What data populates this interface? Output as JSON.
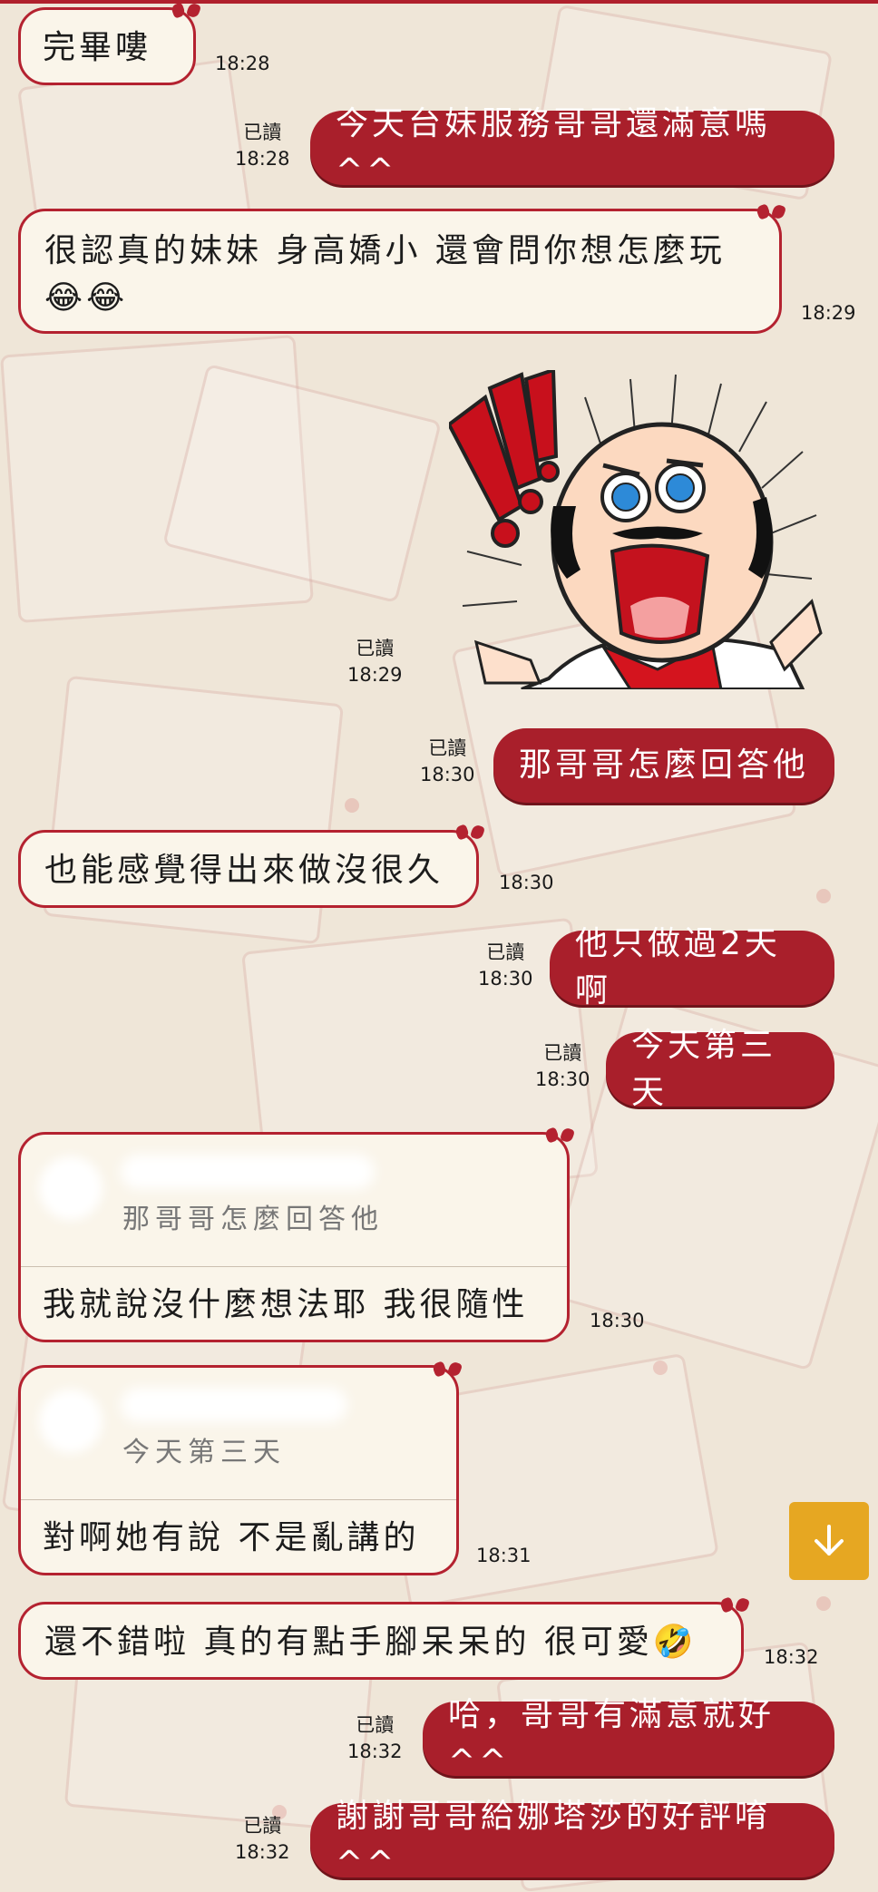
{
  "read_label": "已讀",
  "messages": [
    {
      "id": "m1",
      "side": "in",
      "text": "完畢嘍",
      "time": "18:28"
    },
    {
      "id": "m2",
      "side": "out",
      "text": "今天台妹服務哥哥還滿意嗎^^",
      "time": "18:28"
    },
    {
      "id": "m3",
      "side": "in",
      "text": "很認真的妹妹 身高嬌小 還會問你想怎麼玩😂😂",
      "time": "18:29"
    },
    {
      "id": "m4",
      "side": "out",
      "type": "sticker",
      "sticker": "shocked-old-man-sticker",
      "time": "18:29"
    },
    {
      "id": "m5",
      "side": "out",
      "text": "那哥哥怎麼回答他",
      "time": "18:30"
    },
    {
      "id": "m6",
      "side": "in",
      "text": "也能感覺得出來做沒很久",
      "time": "18:30"
    },
    {
      "id": "m7",
      "side": "out",
      "text": "他只做過2天啊",
      "time": "18:30"
    },
    {
      "id": "m8",
      "side": "out",
      "text": "今天第三天",
      "time": "18:30"
    },
    {
      "id": "m9",
      "side": "in",
      "type": "reply",
      "quote": "那哥哥怎麼回答他",
      "text": "我就說沒什麼想法耶 我很隨性",
      "time": "18:30"
    },
    {
      "id": "m10",
      "side": "in",
      "type": "reply",
      "quote": "今天第三天",
      "text": "對啊她有說 不是亂講的",
      "time": "18:31"
    },
    {
      "id": "m11",
      "side": "in",
      "text": "還不錯啦 真的有點手腳呆呆的 很可愛🤣",
      "time": "18:32"
    },
    {
      "id": "m12",
      "side": "out",
      "text": "哈，哥哥有滿意就好^^",
      "time": "18:32"
    },
    {
      "id": "m13",
      "side": "out",
      "text": "謝謝哥哥給娜塔莎的好評唷^^",
      "time": "18:32"
    }
  ],
  "ui": {
    "scroll_down_icon": "arrow-down-icon",
    "accent_color": "#a91f2b",
    "scroll_button_color": "#e6a722"
  }
}
